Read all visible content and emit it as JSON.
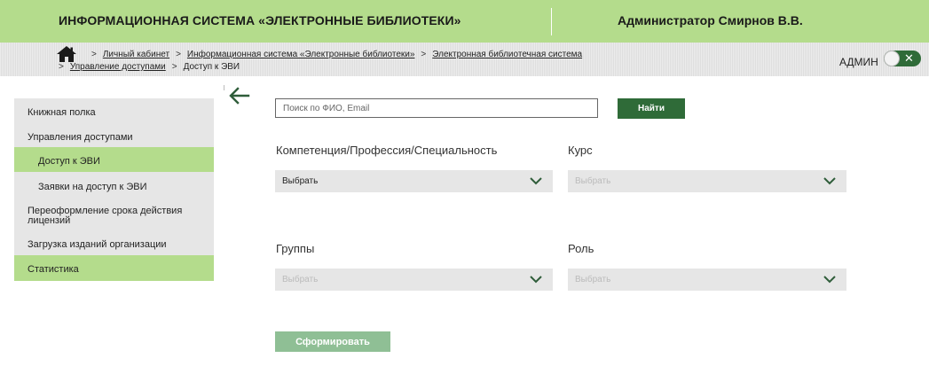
{
  "header": {
    "title": "ИНФОРМАЦИОННАЯ СИСТЕМА «ЭЛЕКТРОННЫЕ БИБЛИОТЕКИ»",
    "user": "Администратор Смирнов В.В."
  },
  "breadcrumb": {
    "items": [
      "Личный кабинет",
      "Информационная система «Электронные библиотеки»",
      "Электронная библиотечная система",
      "Управление доступами",
      "Доступ к ЭВИ"
    ],
    "separator": ">"
  },
  "admin_toggle": {
    "label": "АДМИН",
    "icon": "close-icon",
    "glyph": "✕"
  },
  "sidebar": {
    "items": [
      {
        "label": "Книжная полка",
        "active": false
      },
      {
        "label": "Управления доступами",
        "active": false
      },
      {
        "label": "Доступ к ЭВИ",
        "active": true
      },
      {
        "label": "Заявки на доступ к ЭВИ",
        "active": false
      },
      {
        "label": "Переоформление срока действия лицензий",
        "active": false
      },
      {
        "label": "Загрузка изданий организации",
        "active": false
      },
      {
        "label": "Статистика",
        "active": true
      }
    ]
  },
  "search": {
    "placeholder": "Поиск по ФИО, Email",
    "button": "Найти"
  },
  "filters": {
    "competence": {
      "label": "Компетенция/Профессия/Специальность",
      "value": "Выбрать"
    },
    "course": {
      "label": "Курс",
      "value": "Выбрать"
    },
    "groups": {
      "label": "Группы",
      "value": "Выбрать"
    },
    "role": {
      "label": "Роль",
      "value": "Выбрать"
    }
  },
  "actions": {
    "submit": "Сформировать"
  },
  "colors": {
    "accent": "#b4dc8c",
    "primary": "#2f6b38",
    "disabled_button": "#8fbf95"
  }
}
